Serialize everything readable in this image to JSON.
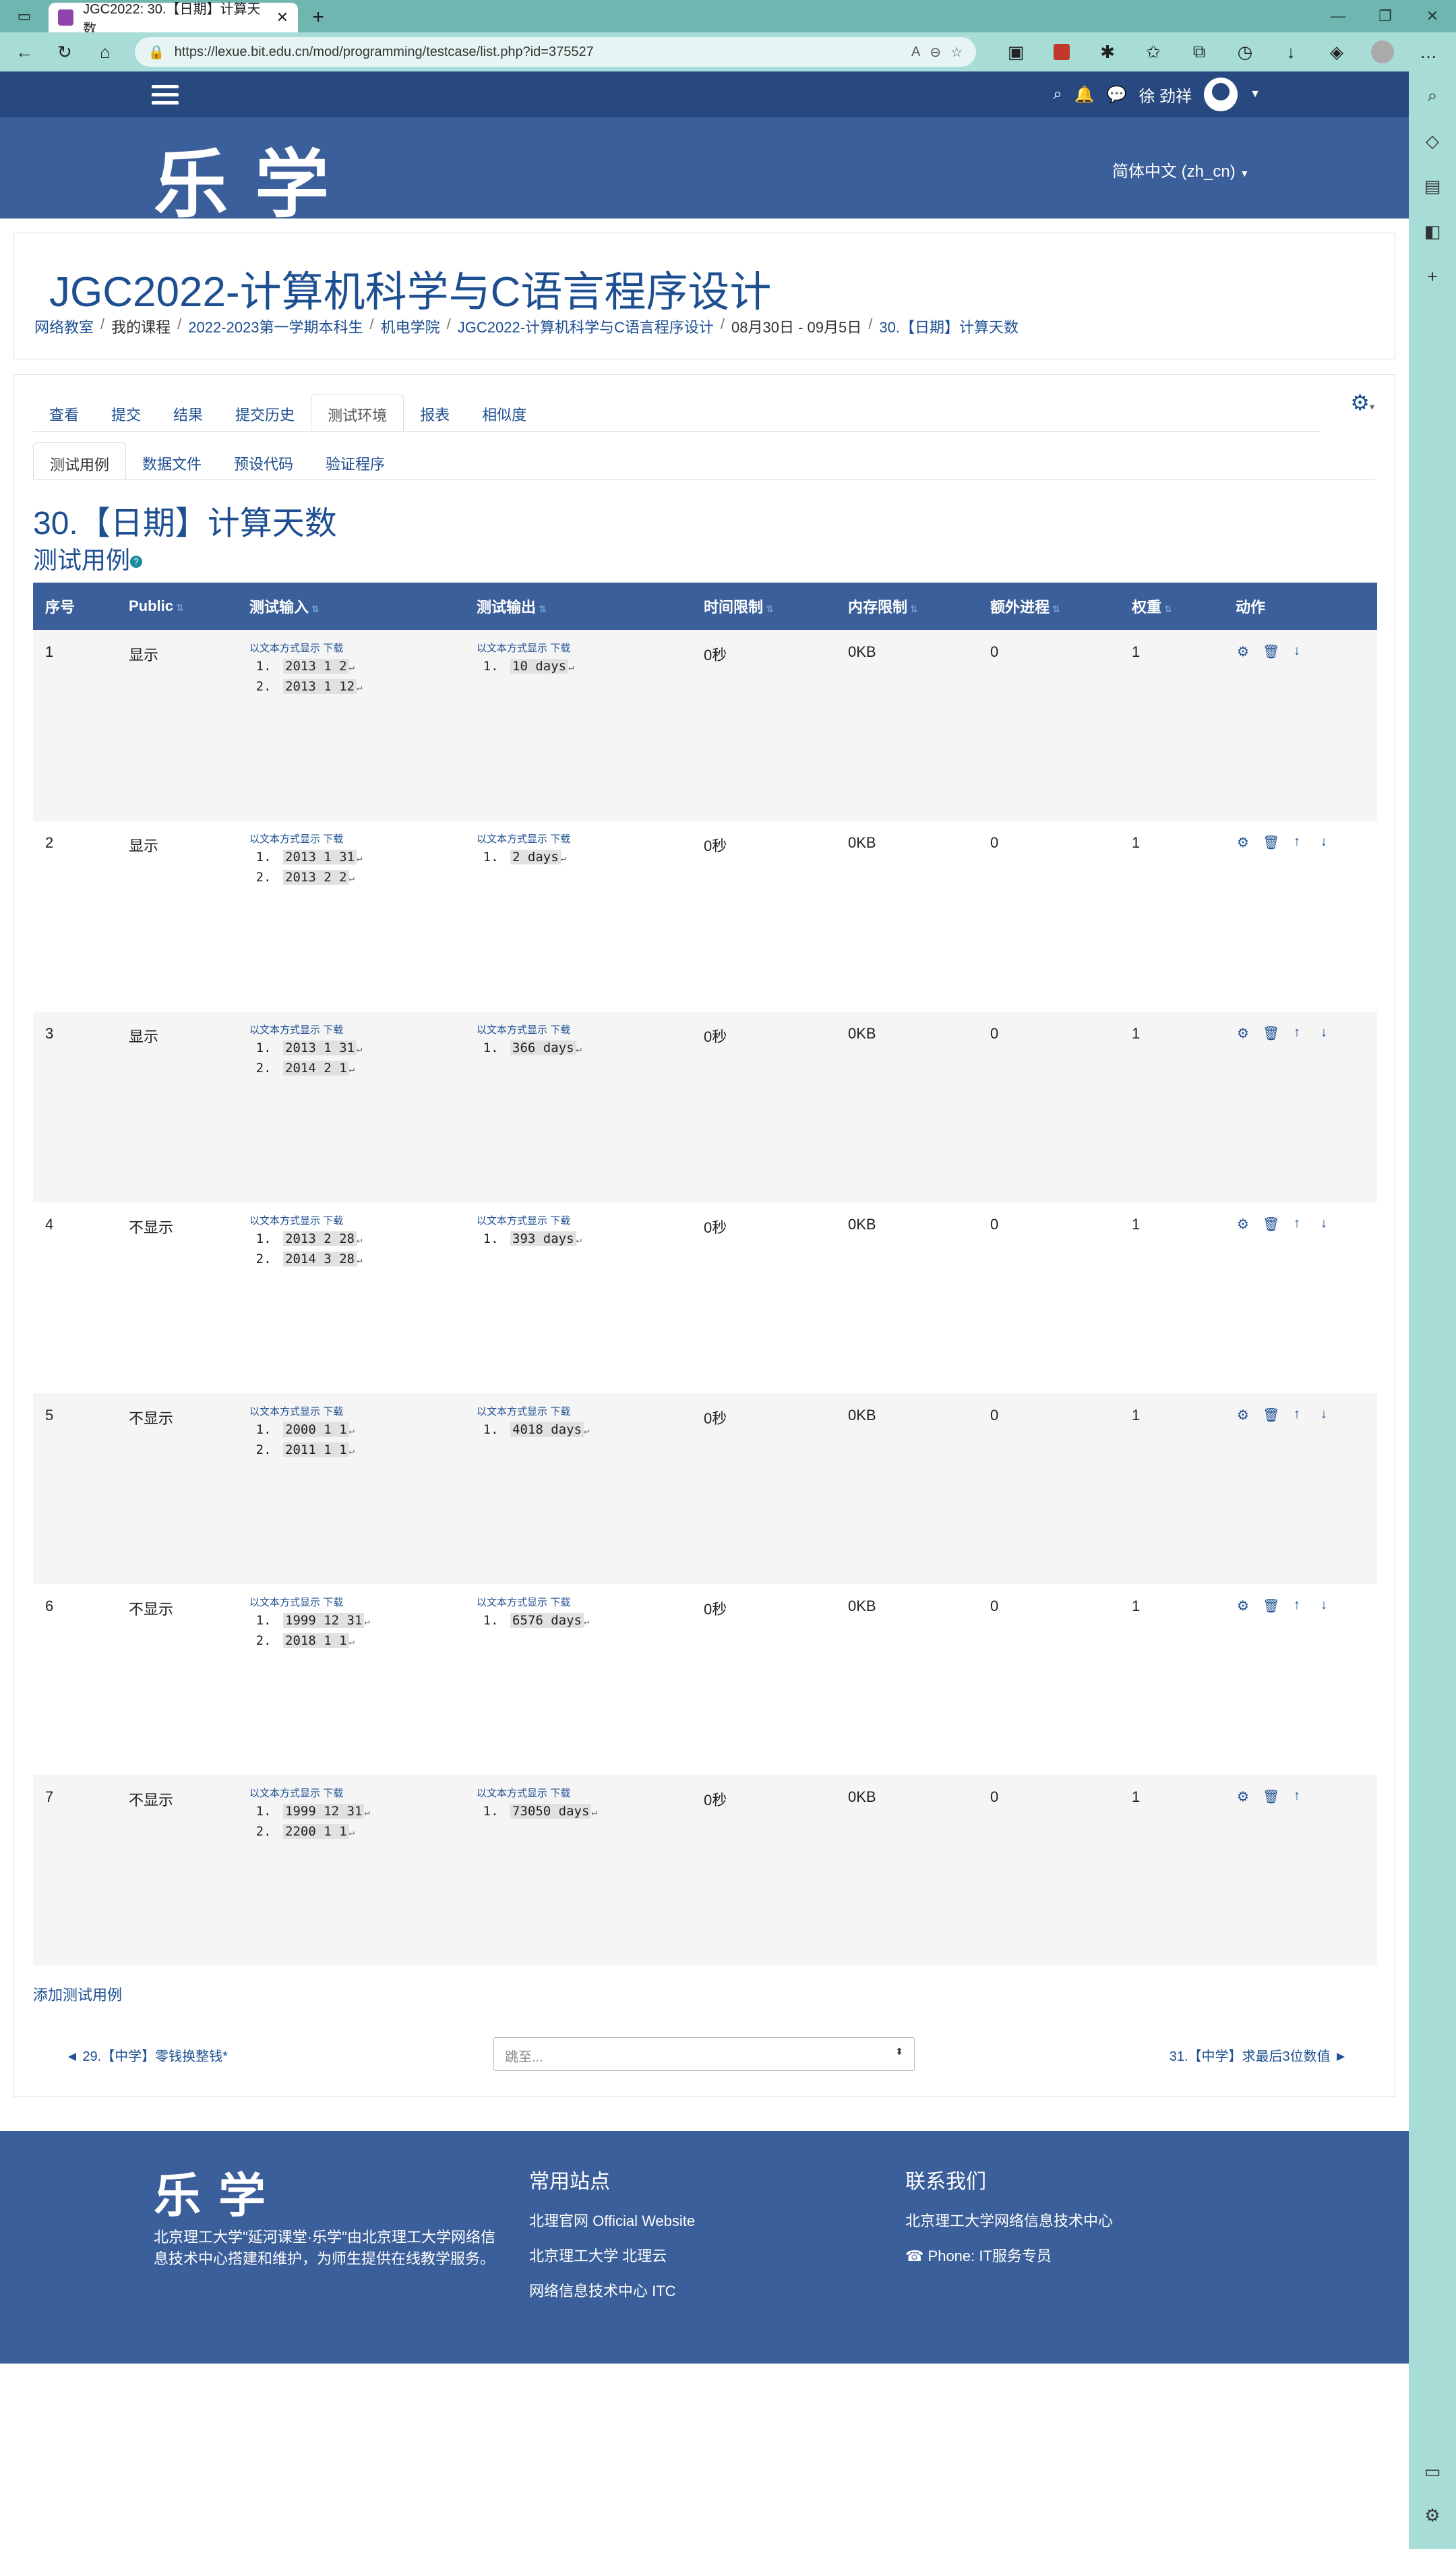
{
  "browser": {
    "tab_title": "JGC2022: 30.【日期】计算天数",
    "url": "https://lexue.bit.edu.cn/mod/programming/testcase/list.php?id=375527"
  },
  "navbar": {
    "user_name": "徐 劲祥"
  },
  "header": {
    "logo": "乐学",
    "language": "简体中文 (zh_cn)"
  },
  "course": {
    "title": "JGC2022-计算机科学与C语言程序设计",
    "breadcrumb": [
      "网络教室",
      "我的课程",
      "2022-2023第一学期本科生",
      "机电学院",
      "JGC2022-计算机科学与C语言程序设计",
      "08月30日 - 09月5日",
      "30.【日期】计算天数"
    ]
  },
  "tabs": {
    "primary": [
      "查看",
      "提交",
      "结果",
      "提交历史",
      "测试环境",
      "报表",
      "相似度"
    ],
    "secondary": [
      "测试用例",
      "数据文件",
      "预设代码",
      "验证程序"
    ]
  },
  "activity": {
    "title": "30.【日期】计算天数",
    "section": "测试用例"
  },
  "table": {
    "headers": [
      "序号",
      "Public",
      "测试输入",
      "测试输出",
      "时间限制",
      "内存限制",
      "额外进程",
      "权重",
      "动作"
    ],
    "link_text": "以文本方式显示",
    "download": "下载",
    "rows": [
      {
        "n": "1",
        "public": "显示",
        "input": [
          "2013 1 2",
          "2013 1 12"
        ],
        "output": [
          "10 days"
        ],
        "time": "0秒",
        "mem": "0KB",
        "proc": "0",
        "weight": "1"
      },
      {
        "n": "2",
        "public": "显示",
        "input": [
          "2013 1 31",
          "2013 2 2"
        ],
        "output": [
          "2 days"
        ],
        "time": "0秒",
        "mem": "0KB",
        "proc": "0",
        "weight": "1"
      },
      {
        "n": "3",
        "public": "显示",
        "input": [
          "2013 1 31",
          "2014 2 1"
        ],
        "output": [
          "366 days"
        ],
        "time": "0秒",
        "mem": "0KB",
        "proc": "0",
        "weight": "1"
      },
      {
        "n": "4",
        "public": "不显示",
        "input": [
          "2013 2 28",
          "2014 3 28"
        ],
        "output": [
          "393 days"
        ],
        "time": "0秒",
        "mem": "0KB",
        "proc": "0",
        "weight": "1"
      },
      {
        "n": "5",
        "public": "不显示",
        "input": [
          "2000 1 1",
          "2011 1 1"
        ],
        "output": [
          "4018 days"
        ],
        "time": "0秒",
        "mem": "0KB",
        "proc": "0",
        "weight": "1"
      },
      {
        "n": "6",
        "public": "不显示",
        "input": [
          "1999 12 31",
          "2018 1 1"
        ],
        "output": [
          "6576 days"
        ],
        "time": "0秒",
        "mem": "0KB",
        "proc": "0",
        "weight": "1"
      },
      {
        "n": "7",
        "public": "不显示",
        "input": [
          "1999 12 31",
          "2200 1 1"
        ],
        "output": [
          "73050 days"
        ],
        "time": "0秒",
        "mem": "0KB",
        "proc": "0",
        "weight": "1"
      }
    ]
  },
  "add_testcase": "添加测试用例",
  "nav": {
    "prev": "◄ 29.【中学】零钱换整钱*",
    "jump_placeholder": "跳至...",
    "next": "31.【中学】求最后3位数值 ►"
  },
  "footer": {
    "logo": "乐学",
    "desc": "北京理工大学\"延河课堂·乐学\"由北京理工大学网络信息技术中心搭建和维护，为师生提供在线教学服务。",
    "col1_title": "常用站点",
    "col1_links": [
      "北理官网 Official Website",
      "北京理工大学 北理云",
      "网络信息技术中心 ITC"
    ],
    "col2_title": "联系我们",
    "col2_lines": [
      "北京理工大学网络信息技术中心",
      "Phone: IT服务专员"
    ]
  }
}
